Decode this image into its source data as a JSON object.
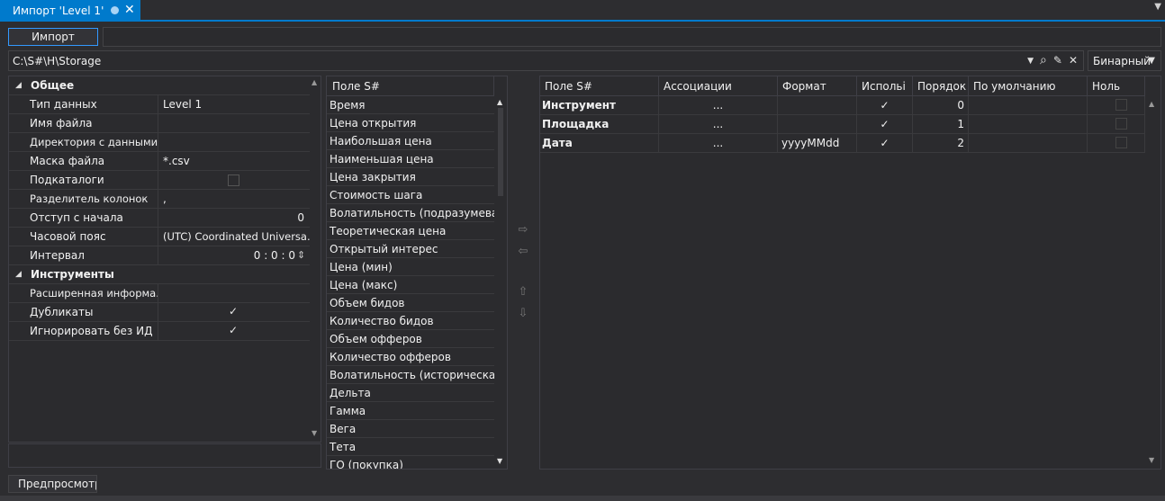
{
  "tab": {
    "title": "Импорт 'Level 1'",
    "close_glyph": "✕"
  },
  "toolbar": {
    "import_label": "Импорт"
  },
  "path": {
    "value": "C:\\S#\\H\\Storage"
  },
  "storage": {
    "selected": "Бинарный"
  },
  "props": {
    "cat_general": "Общее",
    "rows": [
      {
        "name": "Тип данных",
        "value": "Level 1"
      },
      {
        "name": "Имя файла",
        "value": ""
      },
      {
        "name": "Директория с данными",
        "value": ""
      },
      {
        "name": "Маска файла",
        "value": "*.csv"
      },
      {
        "name": "Подкаталоги",
        "value": ""
      },
      {
        "name": "Разделитель колонок",
        "value": ","
      },
      {
        "name": "Отступ с начала",
        "value": "0"
      },
      {
        "name": "Часовой пояс",
        "value": "(UTC) Coordinated Universa..."
      },
      {
        "name": "Интервал",
        "value": "0 : 0 : 0"
      }
    ],
    "cat_instruments": "Инструменты",
    "rows2": [
      {
        "name": "Расширенная информа...",
        "value": ""
      },
      {
        "name": "Дубликаты",
        "value": ""
      },
      {
        "name": "Игнорировать без ИД",
        "value": ""
      }
    ]
  },
  "fields": {
    "header": "Поле S#",
    "items": [
      "Время",
      "Цена открытия",
      "Наибольшая цена",
      "Наименьшая цена",
      "Цена закрытия",
      "Стоимость шага",
      "Волатильность (подразумеваемая)",
      "Теоретическая цена",
      "Открытый интерес",
      "Цена (мин)",
      "Цена (макс)",
      "Объем бидов",
      "Количество бидов",
      "Объем офферов",
      "Количество офферов",
      "Волатильность (историческая)",
      "Дельта",
      "Гамма",
      "Вега",
      "Тета",
      "ГО (покупка)"
    ]
  },
  "grid": {
    "headers": [
      "Поле S#",
      "Ассоциации",
      "Формат",
      "Испольi",
      "Порядок",
      "По умолчанию",
      "Ноль"
    ],
    "rows": [
      {
        "field": "Инструмент",
        "assoc": "...",
        "format": "",
        "order": "0"
      },
      {
        "field": "Площадка",
        "assoc": "...",
        "format": "",
        "order": "1"
      },
      {
        "field": "Дата",
        "assoc": "...",
        "format": "yyyyMMdd",
        "order": "2"
      }
    ]
  },
  "preview": {
    "label": "Предпросмотр"
  },
  "icons": {
    "tick": "✓",
    "cat_tri": "◢",
    "up_tri": "▲",
    "down_tri": "▼",
    "arrow_right": "⇨",
    "arrow_left": "⇦",
    "arrow_up": "⇧",
    "arrow_down": "⇩",
    "search": "⌕",
    "edit": "✎",
    "clear": "✕",
    "dropdown": "▼",
    "spin": "⇕"
  },
  "colors": {
    "accent": "#007acc",
    "background": "#2d2d30",
    "panel": "#2b2b2e",
    "border": "#3f3f46"
  }
}
